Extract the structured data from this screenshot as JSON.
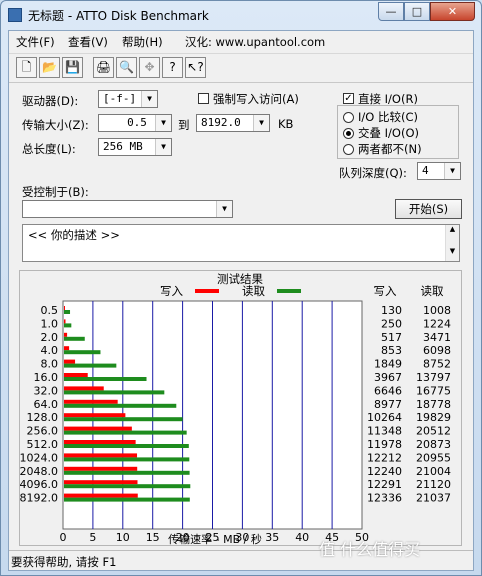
{
  "window": {
    "title": "无标题 - ATTO Disk Benchmark",
    "controls": [
      "—",
      "□",
      "✕"
    ]
  },
  "menu": [
    "文件(F)",
    "查看(V)",
    "帮助(H)",
    "汉化: www.upantool.com"
  ],
  "toolbar": {
    "icons": [
      "new-document-icon",
      "open-folder-icon",
      "save-icon",
      "print-icon",
      "print-preview-icon",
      "move-icon",
      "help-icon",
      "context-help-icon"
    ],
    "glyphs": [
      "🗋",
      "📂",
      "💾",
      "🖨",
      "🔍",
      "✥",
      "?",
      "↖?"
    ]
  },
  "settings": {
    "drive_label": "驱动器(D):",
    "drive_value": "[-f-]",
    "force_write_label": "强制写入访问(A)",
    "transfer_label": "传输大小(Z):",
    "transfer_from": "0.5",
    "transfer_to_label": "到",
    "transfer_to": "8192.0",
    "transfer_unit": "KB",
    "total_label": "总长度(L):",
    "total_value": "256 MB",
    "direct_io_label": "直接 I/O(R)",
    "direct_io_checked": true,
    "io_compare_label": "I/O 比较(C)",
    "overlapped_io_label": "交叠 I/O(O)",
    "neither_label": "两者都不(N)",
    "queue_label": "队列深度(Q):",
    "queue_value": "4",
    "controlled_by_label": "受控制于(B):",
    "controlled_by_value": "",
    "start_button": "开始(S)",
    "description": "<<   你的描述    >>"
  },
  "results": {
    "title": "测试结果",
    "write_legend": "写入",
    "read_legend": "读取",
    "write_header": "写入",
    "read_header": "读取",
    "write_color": "#ff0000",
    "read_color": "#1e8c1e",
    "write_values": [
      "130",
      "250",
      "517",
      "853",
      "1849",
      "3967",
      "6646",
      "8977",
      "10264",
      "11348",
      "11978",
      "12212",
      "12240",
      "12291",
      "12336"
    ],
    "read_values": [
      "1008",
      "1224",
      "3471",
      "6098",
      "8752",
      "13797",
      "16775",
      "18778",
      "19829",
      "20512",
      "20873",
      "20955",
      "21004",
      "21120",
      "21037"
    ]
  },
  "chart_data": {
    "type": "bar",
    "orientation": "horizontal",
    "title": "测试结果",
    "xlabel": "传输速率 - MB / 秒",
    "xlim": [
      0,
      50
    ],
    "xticks": [
      "0",
      "5",
      "10",
      "15",
      "20",
      "25",
      "30",
      "35",
      "40",
      "45",
      "50"
    ],
    "categories": [
      "0.5",
      "1.0",
      "2.0",
      "4.0",
      "8.0",
      "16.0",
      "32.0",
      "64.0",
      "128.0",
      "256.0",
      "512.0",
      "1024.0",
      "2048.0",
      "4096.0",
      "8192.0"
    ],
    "series": [
      {
        "name": "写入",
        "values": [
          0.13,
          0.25,
          0.517,
          0.853,
          1.849,
          3.967,
          6.646,
          8.977,
          10.264,
          11.348,
          11.978,
          12.212,
          12.24,
          12.291,
          12.336
        ]
      },
      {
        "name": "读取",
        "values": [
          1.008,
          1.224,
          3.471,
          6.098,
          8.752,
          13.797,
          16.775,
          18.778,
          19.829,
          20.512,
          20.873,
          20.955,
          21.004,
          21.12,
          21.037
        ]
      }
    ],
    "grid": true,
    "legend": "top"
  },
  "status": "要获得帮助, 请按 F1",
  "watermark": "值 什么值得买"
}
